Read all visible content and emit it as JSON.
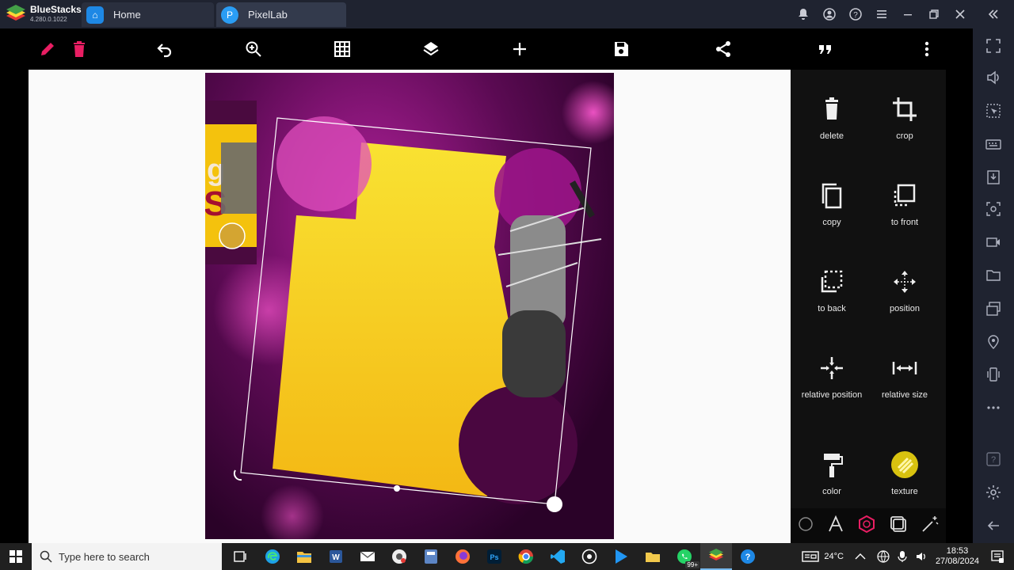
{
  "emulator": {
    "name": "BlueStacks",
    "version": "4.280.0.1022",
    "tabs": [
      {
        "label": "Home"
      },
      {
        "label": "PixelLab"
      }
    ]
  },
  "side_panel": {
    "items": [
      {
        "label": "delete"
      },
      {
        "label": "crop"
      },
      {
        "label": "copy"
      },
      {
        "label": "to front"
      },
      {
        "label": "to back"
      },
      {
        "label": "position"
      },
      {
        "label": "relative position"
      },
      {
        "label": "relative size"
      },
      {
        "label": "color"
      },
      {
        "label": "texture"
      }
    ]
  },
  "canvas_preview": {
    "left_card_text_1": "g",
    "left_card_text_2": "S"
  },
  "taskbar": {
    "search_placeholder": "Type here to search",
    "temperature": "24°C",
    "time": "18:53",
    "date": "27/08/2024",
    "badge": "99+"
  },
  "colors": {
    "accent_pink": "#e91e63",
    "panel_bg": "#111111",
    "title_bg": "#1f2330",
    "poster_yellow": "#f7c91c",
    "poster_purple": "#6a0a63"
  }
}
